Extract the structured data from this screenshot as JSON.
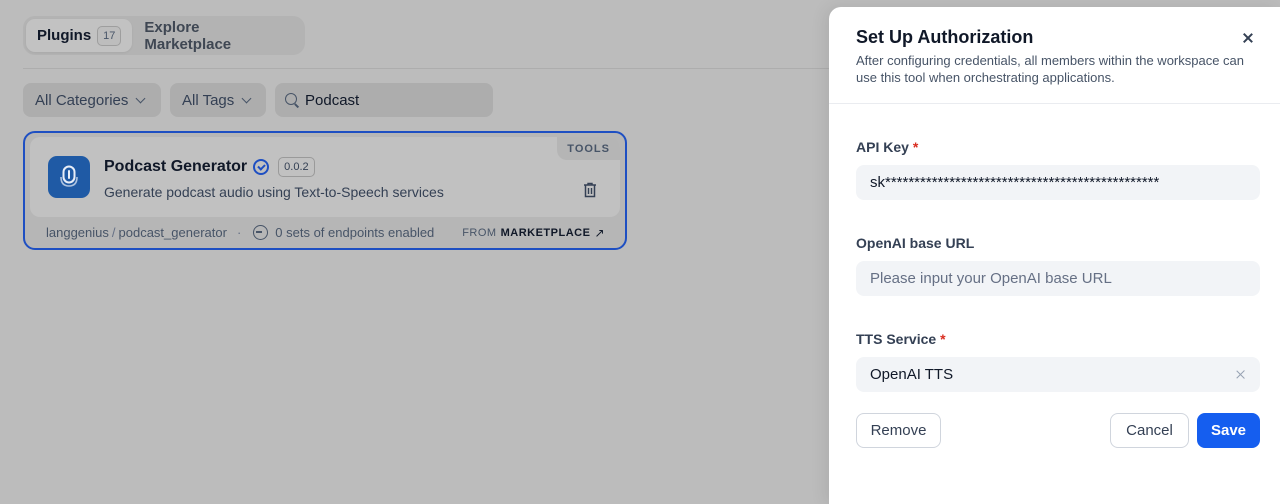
{
  "tabs": {
    "plugins_label": "Plugins",
    "plugins_count": "17",
    "explore_label": "Explore Marketplace"
  },
  "filters": {
    "categories_label": "All Categories",
    "tags_label": "All Tags",
    "search_value": "Podcast"
  },
  "plugin": {
    "name": "Podcast Generator",
    "version": "0.0.2",
    "type_badge": "TOOLS",
    "description": "Generate podcast audio using Text-to-Speech services",
    "author": "langgenius",
    "slug": "podcast_generator",
    "endpoints": "0 sets of endpoints enabled",
    "from_prefix": "FROM",
    "from_source": "MARKETPLACE",
    "icon": "microphone-icon"
  },
  "drawer": {
    "title": "Set Up Authorization",
    "description": "After configuring credentials, all members within the workspace can use this tool when orchestrating applications.",
    "fields": {
      "api_key": {
        "label": "API Key",
        "required_mark": "*",
        "value": "sk***********************************************"
      },
      "base_url": {
        "label": "OpenAI base URL",
        "placeholder": "Please input your OpenAI base URL"
      },
      "tts_service": {
        "label": "TTS Service",
        "required_mark": "*",
        "value": "OpenAI TTS"
      }
    },
    "buttons": {
      "remove": "Remove",
      "cancel": "Cancel",
      "save": "Save"
    }
  },
  "colors": {
    "accent": "#155eef",
    "card_border": "#1e4fc2",
    "required": "#d92d20",
    "overlay": "#bcbcbc"
  }
}
